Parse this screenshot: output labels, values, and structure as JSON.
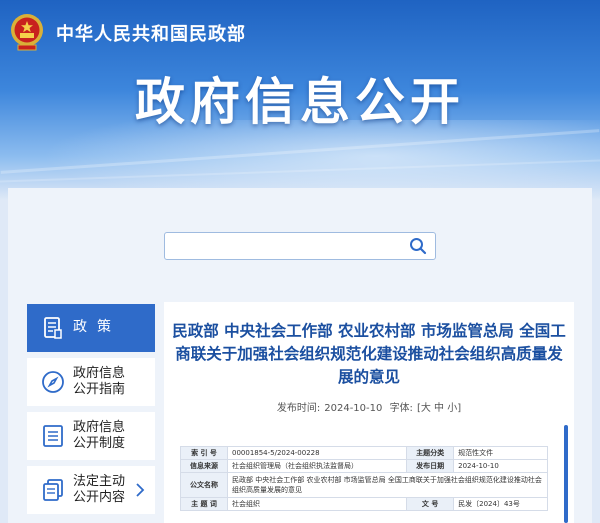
{
  "header": {
    "ministry_name": "中华人民共和国民政部",
    "banner_title": "政府信息公开",
    "emblem_icon": "national-emblem-icon",
    "brand_color": "#1f63c2"
  },
  "search": {
    "value": "",
    "icon": "search-icon"
  },
  "sidebar": {
    "items": [
      {
        "label": "政策",
        "icon": "document-icon",
        "active": true
      },
      {
        "label_line1": "政府信息",
        "label_line2": "公开指南",
        "icon": "compass-icon"
      },
      {
        "label_line1": "政府信息",
        "label_line2": "公开制度",
        "icon": "list-icon"
      },
      {
        "label_line1": "法定主动",
        "label_line2": "公开内容",
        "icon": "copy-icon",
        "arrow": "chevron-right-icon"
      }
    ]
  },
  "article": {
    "title": "民政部 中央社会工作部 农业农村部 市场监管总局 全国工商联关于加强社会组织规范化建设推动社会组织高质量发展的意见",
    "published_label": "发布时间:",
    "published_date": "2024-10-10",
    "font_label": "字体:",
    "font_sizes": "[大 中 小]",
    "info_table": {
      "index_label": "索 引 号",
      "index_value": "00001854-5/2024-00228",
      "category_label": "主题分类",
      "category_value": "规范性文件",
      "source_label": "信息来源",
      "source_value": "社会组织管理局（社会组织执法监督局）",
      "date_label": "发布日期",
      "date_value": "2024-10-10",
      "doc_name_label": "公文名称",
      "doc_name_value": "民政部 中央社会工作部 农业农村部 市场监管总局 全国工商联关于加强社会组织规范化建设推动社会组织高质量发展的意见",
      "keyword_label": "主 题 词",
      "keyword_value": "社会组织",
      "doc_no_label": "文 号",
      "doc_no_value": "民发〔2024〕43号"
    }
  }
}
